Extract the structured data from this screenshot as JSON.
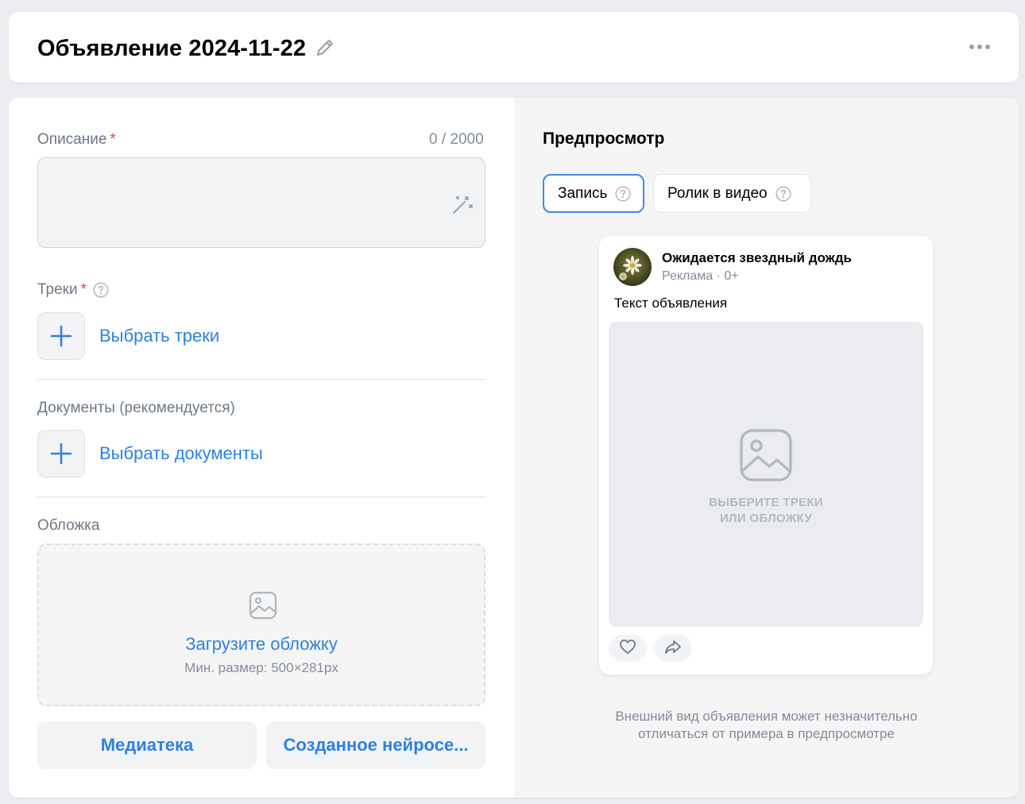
{
  "header": {
    "title": "Объявление 2024-11-22"
  },
  "form": {
    "description": {
      "label": "Описание",
      "required_mark": "*",
      "counter": "0 / 2000",
      "value": ""
    },
    "tracks": {
      "label": "Треки",
      "required_mark": "*",
      "add_label": "Выбрать треки"
    },
    "documents": {
      "label": "Документы (рекомендуется)",
      "add_label": "Выбрать документы"
    },
    "cover": {
      "label": "Обложка",
      "upload_label": "Загрузите обложку",
      "hint": "Мин. размер: 500×281px"
    },
    "buttons": {
      "library": "Медиатека",
      "neural": "Созданное нейросе..."
    }
  },
  "preview": {
    "title": "Предпросмотр",
    "tabs": [
      {
        "label": "Запись",
        "active": true
      },
      {
        "label": "Ролик в видео",
        "active": false
      }
    ],
    "post": {
      "author": "Ожидается звездный дождь",
      "meta": "Реклама · 0+",
      "text": "Текст объявления",
      "placeholder_line1": "ВЫБЕРИТЕ ТРЕКИ",
      "placeholder_line2": "ИЛИ ОБЛОЖКУ"
    },
    "disclaimer_line1": "Внешний вид объявления может незначительно",
    "disclaimer_line2": "отличаться от примера в предпросмотре"
  },
  "colors": {
    "accent": "#2d81e0",
    "required": "#e64646",
    "muted_text": "#818c99"
  }
}
